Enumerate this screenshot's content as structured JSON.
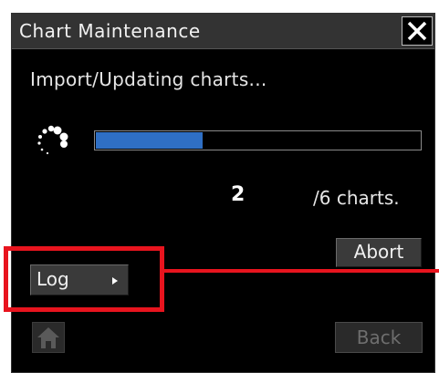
{
  "window": {
    "title": "Chart Maintenance",
    "close_icon": "close-x-icon"
  },
  "status": {
    "message": "Import/Updating charts...",
    "spinner_icon": "loading-spinner-icon",
    "progress_fraction": 0.33,
    "current_count": "2",
    "total_suffix": "/6 charts."
  },
  "buttons": {
    "abort_label": "Abort",
    "log_label": "Log",
    "log_arrow_icon": "triangle-right-icon",
    "home_icon": "home-icon",
    "back_label": "Back"
  },
  "colors": {
    "dialog_bg": "#000000",
    "titlebar_bg": "#333333",
    "progress_fill": "#2f6fc4",
    "highlight": "#e8141e"
  }
}
